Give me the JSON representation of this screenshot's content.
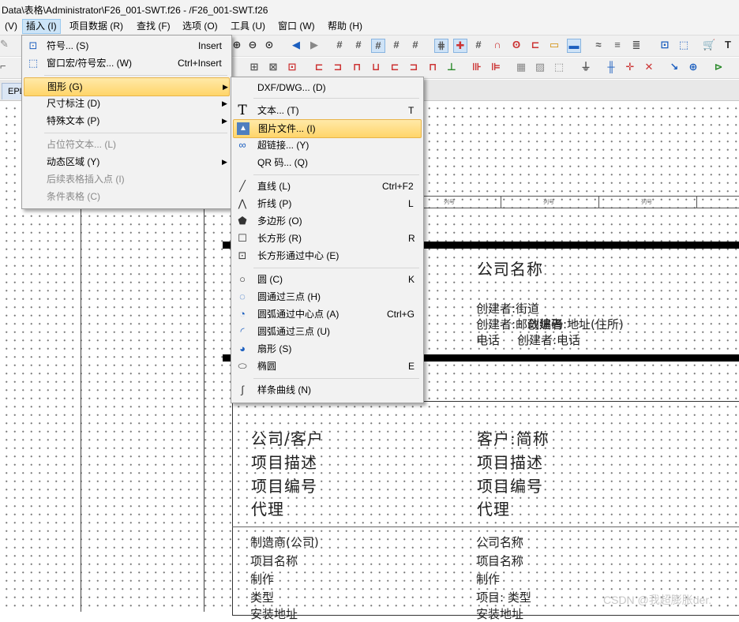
{
  "window": {
    "title": "Data\\表格\\Administrator\\F26_001-SWT.f26 - /F26_001-SWT.f26"
  },
  "menubar": {
    "items": [
      "(V)",
      "插入 (I)",
      "项目数据 (R)",
      "查找 (F)",
      "选项 (O)",
      "工具 (U)",
      "窗口 (W)",
      "帮助 (H)"
    ]
  },
  "tabs": {
    "active": "EPL"
  },
  "insert_menu": {
    "items": [
      {
        "label": "符号... (S)",
        "shortcut": "Insert",
        "icon": "symbol-icon",
        "disabled": false
      },
      {
        "label": "窗口宏/符号宏... (W)",
        "shortcut": "Ctrl+Insert",
        "icon": "macro-icon",
        "disabled": false
      },
      {
        "label": "图形 (G)",
        "submenu": true,
        "highlighted": true
      },
      {
        "label": "尺寸标注 (D)",
        "submenu": true
      },
      {
        "label": "特殊文本 (P)",
        "submenu": true
      },
      {
        "label": "占位符文本... (L)",
        "disabled": true
      },
      {
        "label": "动态区域 (Y)",
        "submenu": true
      },
      {
        "label": "后续表格插入点 (I)",
        "disabled": true
      },
      {
        "label": "条件表格 (C)",
        "disabled": true
      }
    ]
  },
  "graphics_submenu": {
    "items": [
      {
        "label": "DXF/DWG... (D)",
        "shortcut": "",
        "icon": ""
      },
      {
        "label": "文本... (T)",
        "shortcut": "T",
        "icon": "text-icon"
      },
      {
        "label": "图片文件... (I)",
        "shortcut": "",
        "icon": "image-file-icon",
        "highlighted": true
      },
      {
        "label": "超链接... (Y)",
        "shortcut": "",
        "icon": "hyperlink-icon"
      },
      {
        "label": "QR 码... (Q)",
        "shortcut": "",
        "icon": ""
      },
      {
        "label": "直线 (L)",
        "shortcut": "Ctrl+F2",
        "icon": "line-icon"
      },
      {
        "label": "折线 (P)",
        "shortcut": "L",
        "icon": "polyline-icon"
      },
      {
        "label": "多边形 (O)",
        "shortcut": "",
        "icon": "polygon-icon"
      },
      {
        "label": "长方形 (R)",
        "shortcut": "R",
        "icon": "rectangle-icon"
      },
      {
        "label": "长方形通过中心 (E)",
        "shortcut": "",
        "icon": "rectangle-center-icon"
      },
      {
        "label": "圆 (C)",
        "shortcut": "K",
        "icon": "circle-icon"
      },
      {
        "label": "圆通过三点 (H)",
        "shortcut": "",
        "icon": "circle-three-points-icon"
      },
      {
        "label": "圆弧通过中心点 (A)",
        "shortcut": "Ctrl+G",
        "icon": "arc-center-icon"
      },
      {
        "label": "圆弧通过三点 (U)",
        "shortcut": "",
        "icon": "arc-three-points-icon"
      },
      {
        "label": "扇形 (S)",
        "shortcut": "",
        "icon": "sector-icon"
      },
      {
        "label": "椭圆",
        "shortcut": "E",
        "icon": "ellipse-icon"
      },
      {
        "label": "样条曲线 (N)",
        "shortcut": "",
        "icon": "spline-icon"
      }
    ]
  },
  "drawing": {
    "column_labels": [
      "列号",
      "列号",
      "列号"
    ],
    "company_name": "公司名称",
    "creator_street": "创建者:街道",
    "creator_postcode": "创建者:邮政编码",
    "creator_postcode_overlap": "创建者:地址(住所)",
    "phone_label": "电话",
    "creator_phone": "创建者:电话",
    "left_block": [
      "公司/客户",
      "项目描述",
      "项目编号",
      "代理"
    ],
    "right_block": [
      "客户:简称",
      "项目描述",
      "项目编号",
      "代理"
    ],
    "left_fields": [
      "制造商(公司)",
      "项目名称",
      "制作",
      "类型",
      "安装地址"
    ],
    "right_fields": [
      "公司名称",
      "项目名称",
      "制作",
      "项目: 类型",
      "安装地址"
    ]
  },
  "watermark": "CSDN @我超膨胀der."
}
